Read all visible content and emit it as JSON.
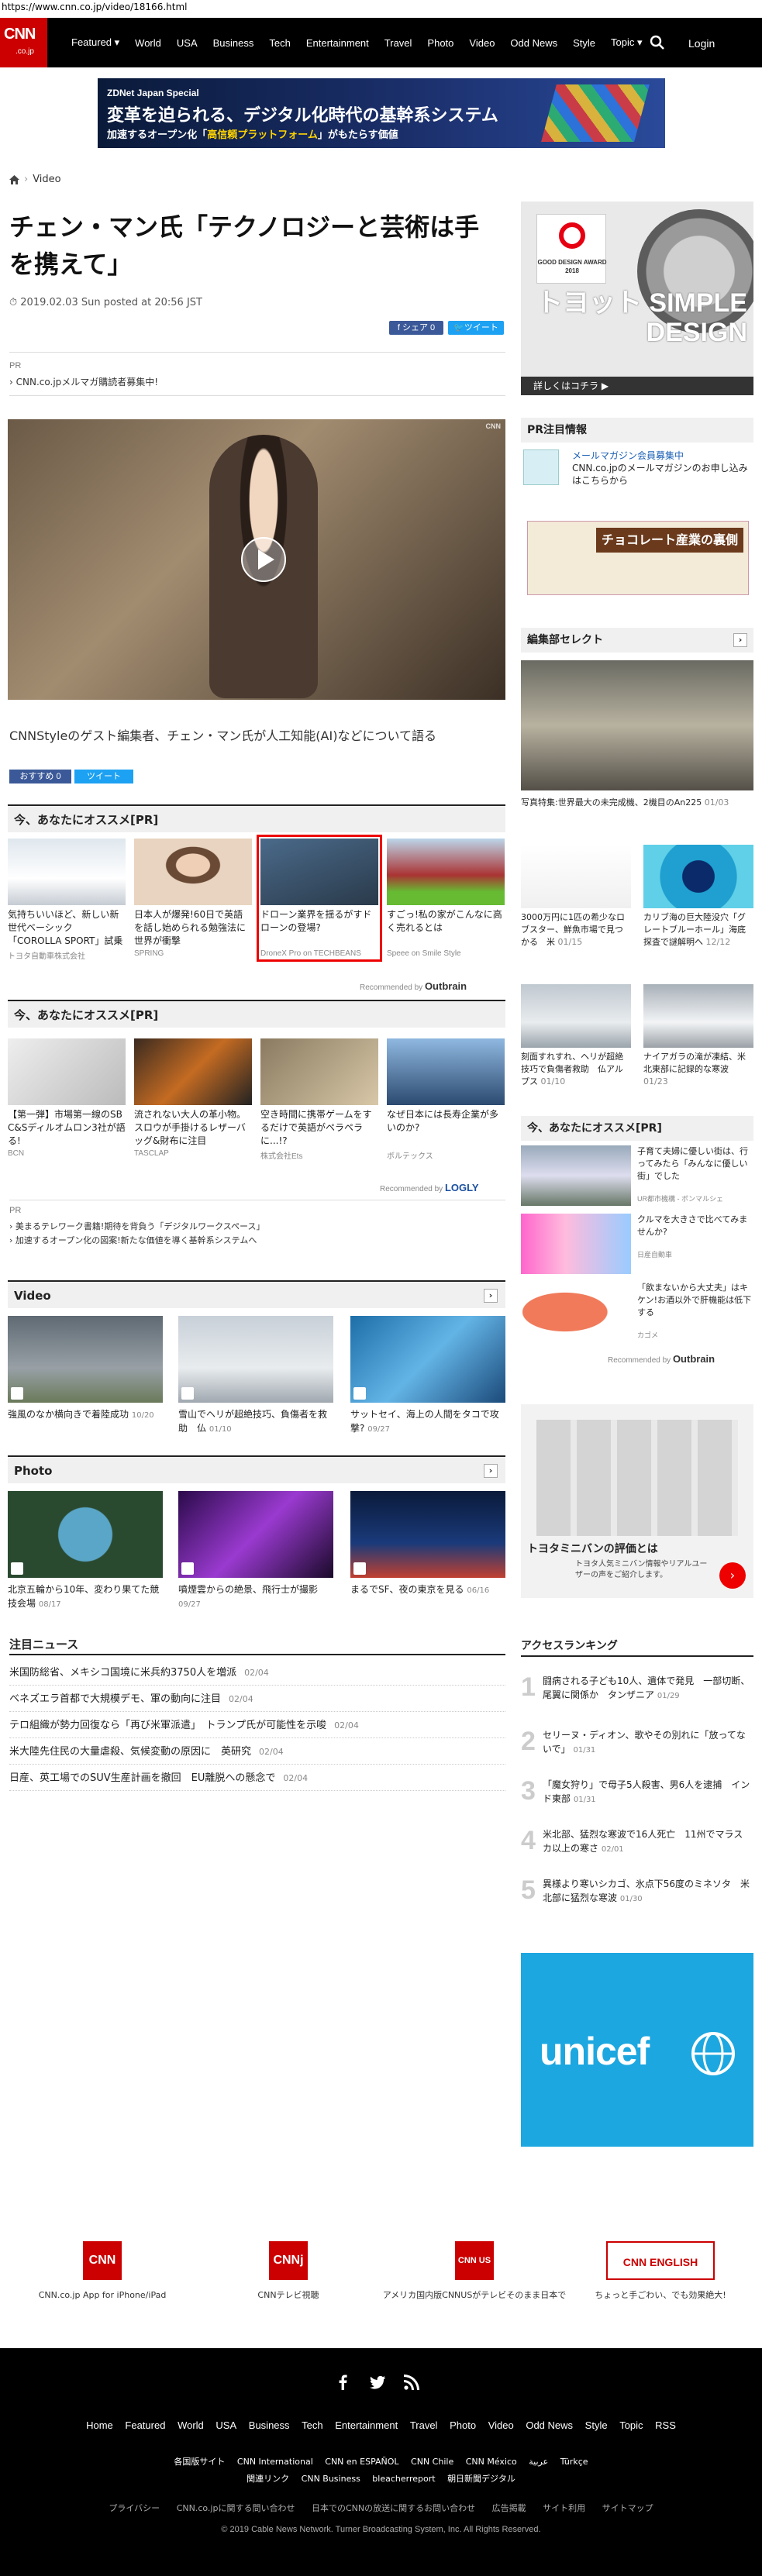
{
  "browser": {
    "url": "https://www.cnn.co.jp/video/18166.html"
  },
  "nav": {
    "logo": "CNN",
    "logo_sub": ".co.jp",
    "items": [
      "Featured ▾",
      "World",
      "USA",
      "Business",
      "Tech",
      "Entertainment",
      "Travel",
      "Photo",
      "Video",
      "Odd News",
      "Style",
      "Topic ▾"
    ],
    "login": "Login"
  },
  "banner": {
    "kicker": "ZDNet Japan Special",
    "headline": "変革を迫られる、デジタル化時代の基幹系システム",
    "sub_a": "加速するオープン化「",
    "sub_em": "高信頼プラットフォーム",
    "sub_b": "」がもたらす価値"
  },
  "breadcrumb": {
    "label": "Video"
  },
  "article": {
    "title": "チェン・マン氏「テクノロジーと芸術は手を携えて」",
    "date": "2019.02.03 Sun posted at 20:56 JST",
    "share_fb": "シェア 0",
    "share_tw": "ツイート",
    "pr_label": "PR",
    "pr_link": "CNN.co.jpメルマガ購読者募集中!",
    "hero_watermark": "CNN",
    "caption": "CNNStyleのゲスト編集者、チェン・マン氏が人工知能(AI)などについて語る",
    "rec_fb": "おすすめ 0",
    "rec_tw": "ツイート"
  },
  "reco1": {
    "title": "今、あなたにオススメ[PR]",
    "cards": [
      {
        "title": "気持ちいいほど、新しい新世代ベーシック「COROLLA SPORT」試乗予約受付中",
        "src": "トヨタ自動車株式会社"
      },
      {
        "title": "日本人が爆発!60日で英語を話し始められる勉強法に世界が衝撃",
        "src": "SPRING"
      },
      {
        "title": "ドローン業界を揺るがすドローンの登場?",
        "src": "DroneX Pro on TECHBEANS"
      },
      {
        "title": "すごっ!私の家がこんなに高く売れるとは",
        "src": "Speee on Smile Style"
      }
    ],
    "by_label": "Recommended by",
    "by_brand": "Outbrain"
  },
  "reco2": {
    "title": "今、あなたにオススメ[PR]",
    "cards": [
      {
        "title": "【第一弾】市場第一線のSB C&Sディルオムロン3社が語る!",
        "src": "BCN"
      },
      {
        "title": "流されない大人の革小物。スロウが手掛けるレザーバッグ&財布に注目",
        "src": "TASCLAP"
      },
      {
        "title": "空き時間に携帯ゲームをするだけで英語がペラペラに...!?",
        "src": "株式会社Ets"
      },
      {
        "title": "なぜ日本には長寿企業が多いのか?",
        "src": "ボルテックス"
      }
    ],
    "by_label": "Recommended by",
    "by_brand": "LOGLY",
    "pr_label": "PR",
    "pr_links": [
      "美まるテレワーク書籍!期待を背負う「デジタルワークスペース」",
      "加速するオープン化の図案!新たな価値を導く基幹系システムへ"
    ]
  },
  "video": {
    "title": "Video",
    "cards": [
      {
        "title": "強風のなか横向きで着陸成功",
        "date": "10/20"
      },
      {
        "title": "雪山でヘリが超絶技巧、負傷者を救助　仏",
        "date": "01/10"
      },
      {
        "title": "サットセイ、海上の人間をタコで攻撃?",
        "date": "09/27"
      }
    ]
  },
  "photo": {
    "title": "Photo",
    "cards": [
      {
        "title": "北京五輪から10年、変わり果てた競技会場",
        "date": "08/17"
      },
      {
        "title": "噴煙雲からの絶景、飛行士が撮影",
        "date": "09/27"
      },
      {
        "title": "まるでSF、夜の東京を見る",
        "date": "06/16"
      }
    ]
  },
  "news": {
    "title": "注目ニュース",
    "items": [
      {
        "text": "米国防総省、メキシコ国境に米兵約3750人を増派",
        "date": "02/04"
      },
      {
        "text": "ベネズエラ首都で大規模デモ、軍の動向に注目",
        "date": "02/04"
      },
      {
        "text": "テロ組織が勢力回復なら「再び米軍派遣」　トランプ氏が可能性を示唆",
        "date": "02/04"
      },
      {
        "text": "米大陸先住民の大量虐殺、気候変動の原因に　英研究",
        "date": "02/04"
      },
      {
        "text": "日産、英工場でのSUV生産計画を撤回　EU離脱への懸念で",
        "date": "02/04"
      }
    ]
  },
  "sidebar": {
    "ad": {
      "gd_label": "GOOD DESIGN AWARD 2018",
      "big": "トヨット SIMPLE DESIGN",
      "bar": "詳しくはコチラ ▶"
    },
    "pr_head": "PR注目情報",
    "pr_item_title": "メールマガジン会員募集中",
    "pr_item_body": "CNN.co.jpのメールマガジンのお申し込みはこちらから",
    "choco": "チョコレート産業の裏側",
    "editor_head": "編集部セレクト",
    "editor_caption": "写真特集:世界最大の未完成機、2機目のAn225",
    "editor_date": "01/03",
    "grid": [
      {
        "title": "3000万円に1匹の希少なロブスター、鮮魚市場で見つかる　米",
        "date": "01/15"
      },
      {
        "title": "カリブ海の巨大陸没穴「グレートブルーホール」海底探査で謎解明へ",
        "date": "12/12"
      },
      {
        "title": "刻面すれすれ、ヘリが超絶技巧で負傷者救助　仏アルプス",
        "date": "01/10"
      },
      {
        "title": "ナイアガラの滝が凍結、米北東部に記録的な寒波",
        "date": "01/23"
      }
    ],
    "reco_head": "今、あなたにオススメ[PR]",
    "reco_items": [
      {
        "title": "子育て夫婦に優しい街は、行ってみたら「みんなに優しい街」でした",
        "src": "UR都市機構 - ボンマルシェ"
      },
      {
        "title": "クルマを大きさで比べてみませんか?",
        "src": "日産自動車"
      },
      {
        "title": "「飲まないから大丈夫」はキケン!お酒以外で肝機能は低下する",
        "src": "カゴメ"
      }
    ],
    "reco_by": "Recommended by",
    "reco_brand": "Outbrain",
    "toyota_title": "トヨタミニバンの評価とは",
    "toyota_body": "トヨタ人気ミニバン情報やリアルユーザーの声をご紹介します。",
    "rank_head": "アクセスランキング",
    "rank": [
      {
        "text": "闘病される子ども10人、遺体で発見　一部切断、尾翼に関係か　タンザニア",
        "date": "01/29"
      },
      {
        "text": "セリーヌ・ディオン、歌やその別れに「放ってないで」",
        "date": "01/31"
      },
      {
        "text": "「魔女狩り」で母子5人殺害、男6人を逮捕　インド東部",
        "date": "01/31"
      },
      {
        "text": "米北部、猛烈な寒波で16人死亡　11州でマラスカ以上の寒さ",
        "date": "02/01"
      },
      {
        "text": "異様より寒いシカゴ、氷点下56度のミネソタ　米北部に猛烈な寒波",
        "date": "01/30"
      }
    ],
    "unicef": "unicef"
  },
  "apps": [
    {
      "logo": "CNN",
      "label": "CNN.co.jp App for iPhone/iPad"
    },
    {
      "logo": "CNNj",
      "label": "CNNテレビ視聴"
    },
    {
      "logo": "CNN US",
      "label": "アメリカ国内版CNNUSがテレビそのまま日本で"
    },
    {
      "logo": "CNN ENGLISH",
      "label": "ちょっと手ごわい、でも効果絶大!"
    }
  ],
  "footer": {
    "nav": [
      "Home",
      "Featured",
      "World",
      "USA",
      "Business",
      "Tech",
      "Entertainment",
      "Travel",
      "Photo",
      "Video",
      "Odd News",
      "Style",
      "Topic",
      "RSS"
    ],
    "sites_a": [
      "各国版サイト",
      "CNN International",
      "CNN en ESPAÑOL",
      "CNN Chile",
      "CNN México",
      "عربية",
      "Türkçe"
    ],
    "sites_b": [
      "関連リンク",
      "CNN Business",
      "bleacherreport",
      "朝日新聞デジタル"
    ],
    "legal": [
      "プライバシー",
      "CNN.co.jpに関する問い合わせ",
      "日本でのCNNの放送に関するお問い合わせ",
      "広告掲載",
      "サイト利用",
      "サイトマップ"
    ],
    "copyright": "© 2019 Cable News Network.  Turner Broadcasting System, Inc.  All Rights Reserved."
  }
}
